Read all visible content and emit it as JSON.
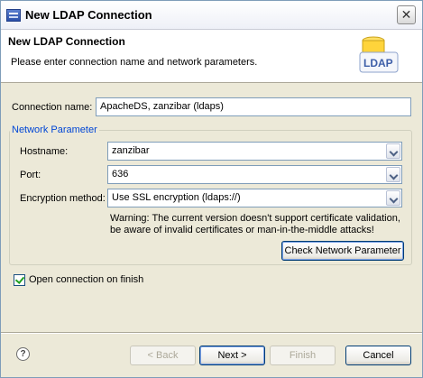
{
  "window": {
    "title": "New LDAP Connection"
  },
  "header": {
    "title": "New LDAP Connection",
    "description": "Please enter connection name and network parameters.",
    "logo_text": "LDAP"
  },
  "form": {
    "connection_name_label": "Connection name:",
    "connection_name_value": "ApacheDS, zanzibar (ldaps)",
    "group_title": "Network Parameter",
    "hostname_label": "Hostname:",
    "hostname_value": "zanzibar",
    "port_label": "Port:",
    "port_value": "636",
    "encryption_label": "Encryption method:",
    "encryption_value": "Use SSL encryption (ldaps://)",
    "warning_line1": "Warning: The current version doesn't support certificate validation,",
    "warning_line2": "be aware of invalid certificates or man-in-the-middle attacks!",
    "check_button": "Check Network Parameter",
    "open_on_finish_label": "Open connection on finish",
    "open_on_finish_checked": true
  },
  "footer": {
    "help_icon": "?",
    "back": "< Back",
    "next": "Next >",
    "finish": "Finish",
    "cancel": "Cancel"
  }
}
